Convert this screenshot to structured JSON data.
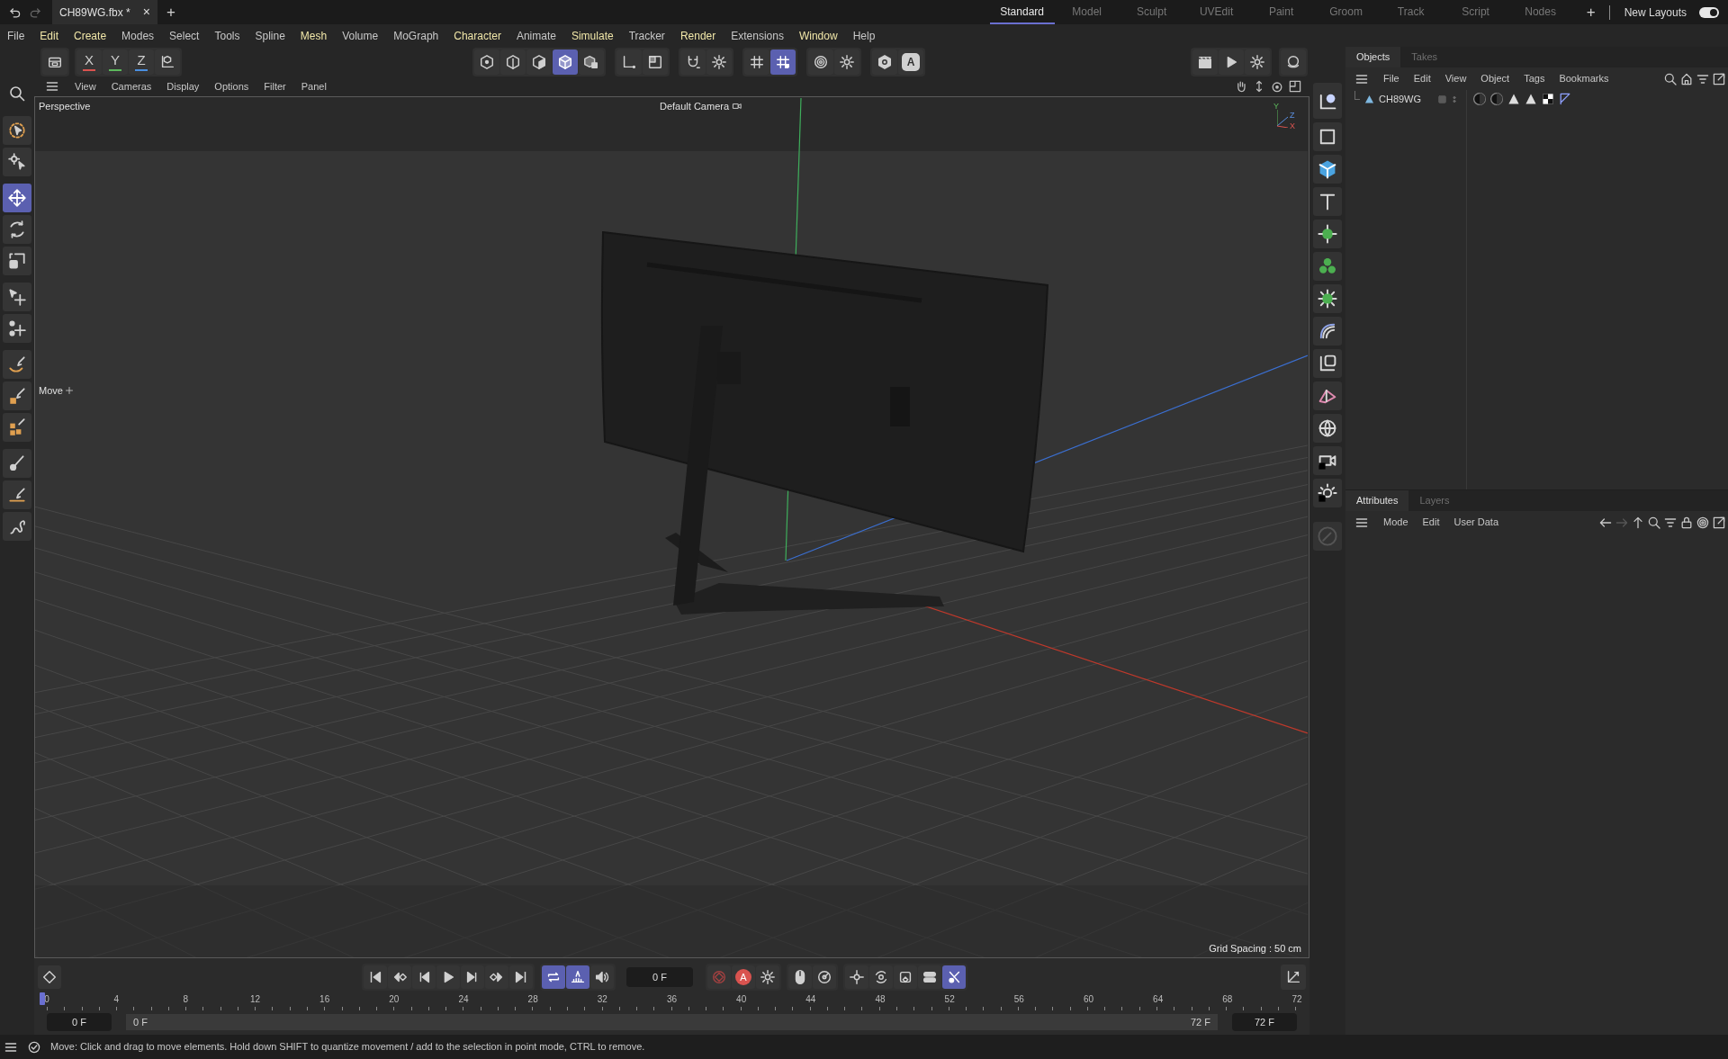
{
  "title_bar": {
    "tabs": [
      {
        "label": "CH89WG.fbx *",
        "close": "×",
        "selected": true
      }
    ],
    "add_tab": "+"
  },
  "layouts": {
    "items": [
      {
        "label": "Standard",
        "selected": true
      },
      {
        "label": "Model",
        "selected": false
      },
      {
        "label": "Sculpt",
        "selected": false
      },
      {
        "label": "UVEdit",
        "selected": false
      },
      {
        "label": "Paint",
        "selected": false
      },
      {
        "label": "Groom",
        "selected": false
      },
      {
        "label": "Track",
        "selected": false
      },
      {
        "label": "Script",
        "selected": false
      },
      {
        "label": "Nodes",
        "selected": false
      }
    ],
    "add": "+",
    "new_layouts": "New Layouts",
    "toggle_on": true
  },
  "menu_bar": [
    {
      "label": "File",
      "highlighted": false
    },
    {
      "label": "Edit",
      "highlighted": true
    },
    {
      "label": "Create",
      "highlighted": true
    },
    {
      "label": "Modes",
      "highlighted": false
    },
    {
      "label": "Select",
      "highlighted": false
    },
    {
      "label": "Tools",
      "highlighted": false
    },
    {
      "label": "Spline",
      "highlighted": false
    },
    {
      "label": "Mesh",
      "highlighted": true
    },
    {
      "label": "Volume",
      "highlighted": false
    },
    {
      "label": "MoGraph",
      "highlighted": false
    },
    {
      "label": "Character",
      "highlighted": true
    },
    {
      "label": "Animate",
      "highlighted": false
    },
    {
      "label": "Simulate",
      "highlighted": true
    },
    {
      "label": "Tracker",
      "highlighted": false
    },
    {
      "label": "Render",
      "highlighted": true
    },
    {
      "label": "Extensions",
      "highlighted": false
    },
    {
      "label": "Window",
      "highlighted": true
    },
    {
      "label": "Help",
      "highlighted": false
    }
  ],
  "toolbar": {
    "axis_locks": [
      {
        "label": "X",
        "color": "#d9534f"
      },
      {
        "label": "Y",
        "color": "#5cb85c"
      },
      {
        "label": "Z",
        "color": "#4a8fe0"
      }
    ],
    "buttons": [
      {
        "selected": false
      },
      {
        "selected": false
      },
      {
        "selected": false
      },
      {
        "selected": false
      },
      {
        "selected": false
      },
      {
        "selected": true
      },
      {
        "selected": false
      },
      {
        "selected": false
      },
      {
        "selected": false
      },
      {
        "selected": false
      },
      {
        "selected": false
      },
      {
        "selected": false
      },
      {
        "selected": true
      },
      {
        "selected": false
      },
      {
        "selected": false
      },
      {
        "selected": false
      },
      {
        "selected": false
      },
      {
        "selected": false
      },
      {
        "selected": false
      },
      {
        "selected": false
      },
      {
        "selected": false
      }
    ],
    "badge": "A"
  },
  "left_tools": [
    {
      "selected": false
    },
    {
      "selected": false
    },
    {
      "selected": true
    },
    {
      "selected": false
    },
    {
      "selected": false
    },
    {
      "selected": false
    },
    {
      "selected": false
    },
    {
      "selected": false
    },
    {
      "selected": false
    },
    {
      "selected": false
    },
    {
      "selected": false
    },
    {
      "selected": false
    },
    {
      "selected": false
    }
  ],
  "viewport": {
    "menu": [
      "View",
      "Cameras",
      "Display",
      "Options",
      "Filter",
      "Panel"
    ],
    "view_name": "Perspective",
    "camera": "Default Camera",
    "tool_label": "Move",
    "gizmo": [
      "Y",
      "Z",
      "X"
    ],
    "grid_spacing": "Grid Spacing : 50 cm"
  },
  "objects_panel": {
    "tabs": [
      {
        "label": "Objects",
        "selected": true
      },
      {
        "label": "Takes",
        "selected": false
      }
    ],
    "menu": [
      "File",
      "Edit",
      "View",
      "Object",
      "Tags",
      "Bookmarks"
    ],
    "objects": [
      {
        "name": "CH89WG"
      }
    ]
  },
  "attributes_panel": {
    "tabs": [
      {
        "label": "Attributes",
        "selected": true
      },
      {
        "label": "Layers",
        "selected": false
      }
    ],
    "menu": [
      "Mode",
      "Edit",
      "User Data"
    ]
  },
  "timeline": {
    "loop_buttons": [
      {
        "selected": true
      },
      {
        "selected": true
      },
      {
        "selected": false
      }
    ],
    "key_buttons": [
      {
        "selected": false
      },
      {
        "selected": false
      },
      {
        "selected": false
      },
      {
        "selected": false
      },
      {
        "selected": true
      }
    ],
    "current_frame": "0 F",
    "autokey": "A",
    "ruler": [
      "0",
      "4",
      "8",
      "12",
      "16",
      "20",
      "24",
      "28",
      "32",
      "36",
      "40",
      "44",
      "48",
      "52",
      "56",
      "60",
      "64",
      "68",
      "72"
    ],
    "range_start": "0 F",
    "range_bar_start": "0 F",
    "range_bar_end": "72 F",
    "range_end": "72 F"
  },
  "status_bar": {
    "message": "Move: Click and drag to move elements. Hold down SHIFT to quantize movement / add to the selection in point mode, CTRL to remove."
  }
}
